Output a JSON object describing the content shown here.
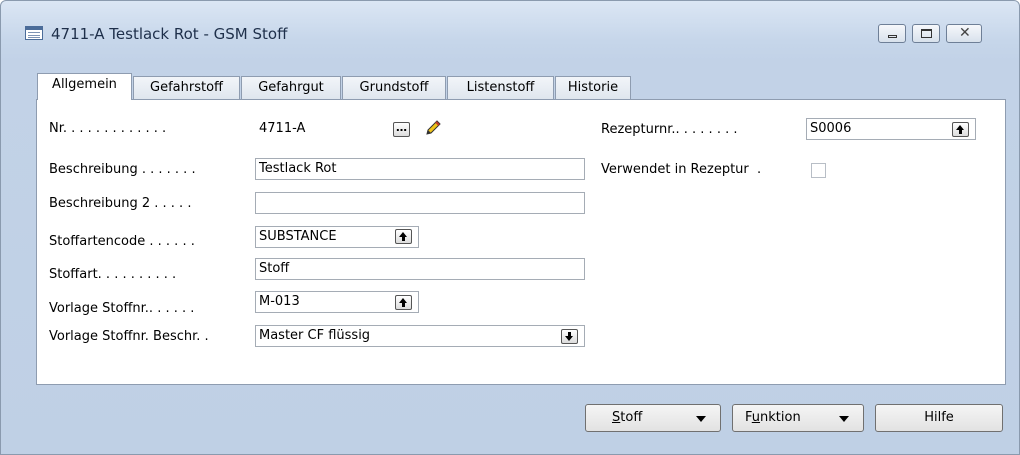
{
  "window": {
    "title": "4711-A Testlack Rot - GSM Stoff",
    "minimize_label": "minimize",
    "maximize_label": "maximize",
    "close_label": "close"
  },
  "tabs": [
    {
      "label": "Allgemein",
      "active": true
    },
    {
      "label": "Gefahrstoff",
      "active": false
    },
    {
      "label": "Gefahrgut",
      "active": false
    },
    {
      "label": "Grundstoff",
      "active": false
    },
    {
      "label": "Listenstoff",
      "active": false
    },
    {
      "label": "Historie",
      "active": false
    }
  ],
  "form": {
    "nr": {
      "label": "Nr. . . . . . . . . . . . .",
      "value": "4711-A"
    },
    "beschreibung": {
      "label": "Beschreibung . . . . . . .",
      "value": "Testlack Rot"
    },
    "beschreibung2": {
      "label": "Beschreibung 2 . . . . .",
      "value": ""
    },
    "stoffartencode": {
      "label": "Stoffartencode . . . . . .",
      "value": "SUBSTANCE"
    },
    "stoffart": {
      "label": "Stoffart. . . . . . . . . .",
      "value": "Stoff"
    },
    "vorlage_stoffnr": {
      "label": "Vorlage Stoffnr.. . . . . .",
      "value": "M-013"
    },
    "vorlage_beschr": {
      "label": "Vorlage Stoffnr. Beschr. .",
      "value": "Master CF flüssig"
    },
    "rezepturnr": {
      "label": "Rezepturnr.. . . . . . . .",
      "value": "S0006"
    },
    "verwendet": {
      "label": "Verwendet in Rezeptur  .",
      "checked": false
    }
  },
  "buttons": {
    "stoff_prefix": "S",
    "stoff_rest": "toff",
    "funktion_prefix": "F",
    "funktion_u": "u",
    "funktion_rest": "nktion",
    "hilfe": "Hilfe"
  },
  "icons": {
    "lookup": "ellipsis-icon",
    "edit": "pencil-icon",
    "drilldown_up": "arrow-up-icon",
    "dropdown_down": "arrow-down-icon"
  }
}
